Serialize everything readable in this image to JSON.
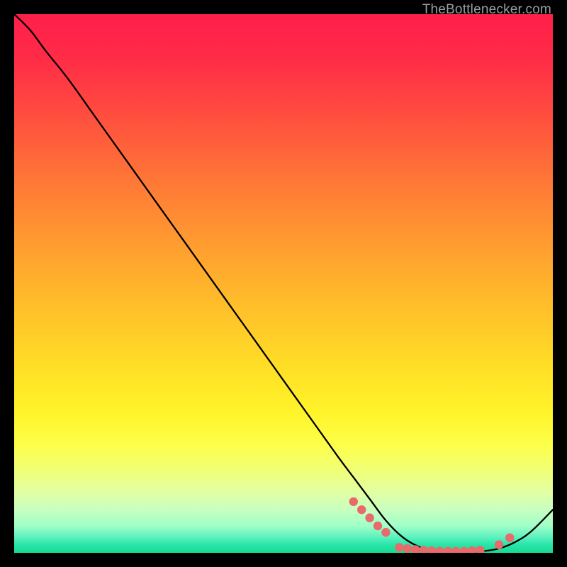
{
  "watermark": "TheBottlenecker.com",
  "chart_data": {
    "type": "line",
    "title": "",
    "xlabel": "",
    "ylabel": "",
    "xlim": [
      0,
      100
    ],
    "ylim": [
      0,
      100
    ],
    "series": [
      {
        "name": "curve",
        "x": [
          0,
          3,
          6,
          10,
          15,
          20,
          25,
          30,
          35,
          40,
          45,
          50,
          55,
          60,
          63,
          66,
          69,
          72,
          75,
          78,
          81,
          84,
          87,
          90,
          93,
          96,
          100
        ],
        "y": [
          100,
          97,
          93,
          88,
          81,
          74,
          67,
          60,
          53,
          46,
          39,
          32,
          25,
          18,
          14,
          10,
          6,
          3,
          1.2,
          0.4,
          0.1,
          0.1,
          0.3,
          0.8,
          2.0,
          4.0,
          8.0
        ]
      }
    ],
    "markers": [
      {
        "x": 63.0,
        "y": 9.5
      },
      {
        "x": 64.5,
        "y": 8.0
      },
      {
        "x": 66.0,
        "y": 6.5
      },
      {
        "x": 67.5,
        "y": 5.0
      },
      {
        "x": 69.0,
        "y": 3.8
      },
      {
        "x": 71.5,
        "y": 1.0
      },
      {
        "x": 73.0,
        "y": 0.8
      },
      {
        "x": 74.5,
        "y": 0.6
      },
      {
        "x": 76.0,
        "y": 0.5
      },
      {
        "x": 77.5,
        "y": 0.4
      },
      {
        "x": 79.0,
        "y": 0.3
      },
      {
        "x": 80.5,
        "y": 0.3
      },
      {
        "x": 82.0,
        "y": 0.3
      },
      {
        "x": 83.5,
        "y": 0.3
      },
      {
        "x": 85.0,
        "y": 0.4
      },
      {
        "x": 86.5,
        "y": 0.5
      },
      {
        "x": 90.0,
        "y": 1.5
      },
      {
        "x": 92.0,
        "y": 2.8
      }
    ],
    "colors": {
      "line": "#000000",
      "marker": "#e86a6a"
    }
  }
}
